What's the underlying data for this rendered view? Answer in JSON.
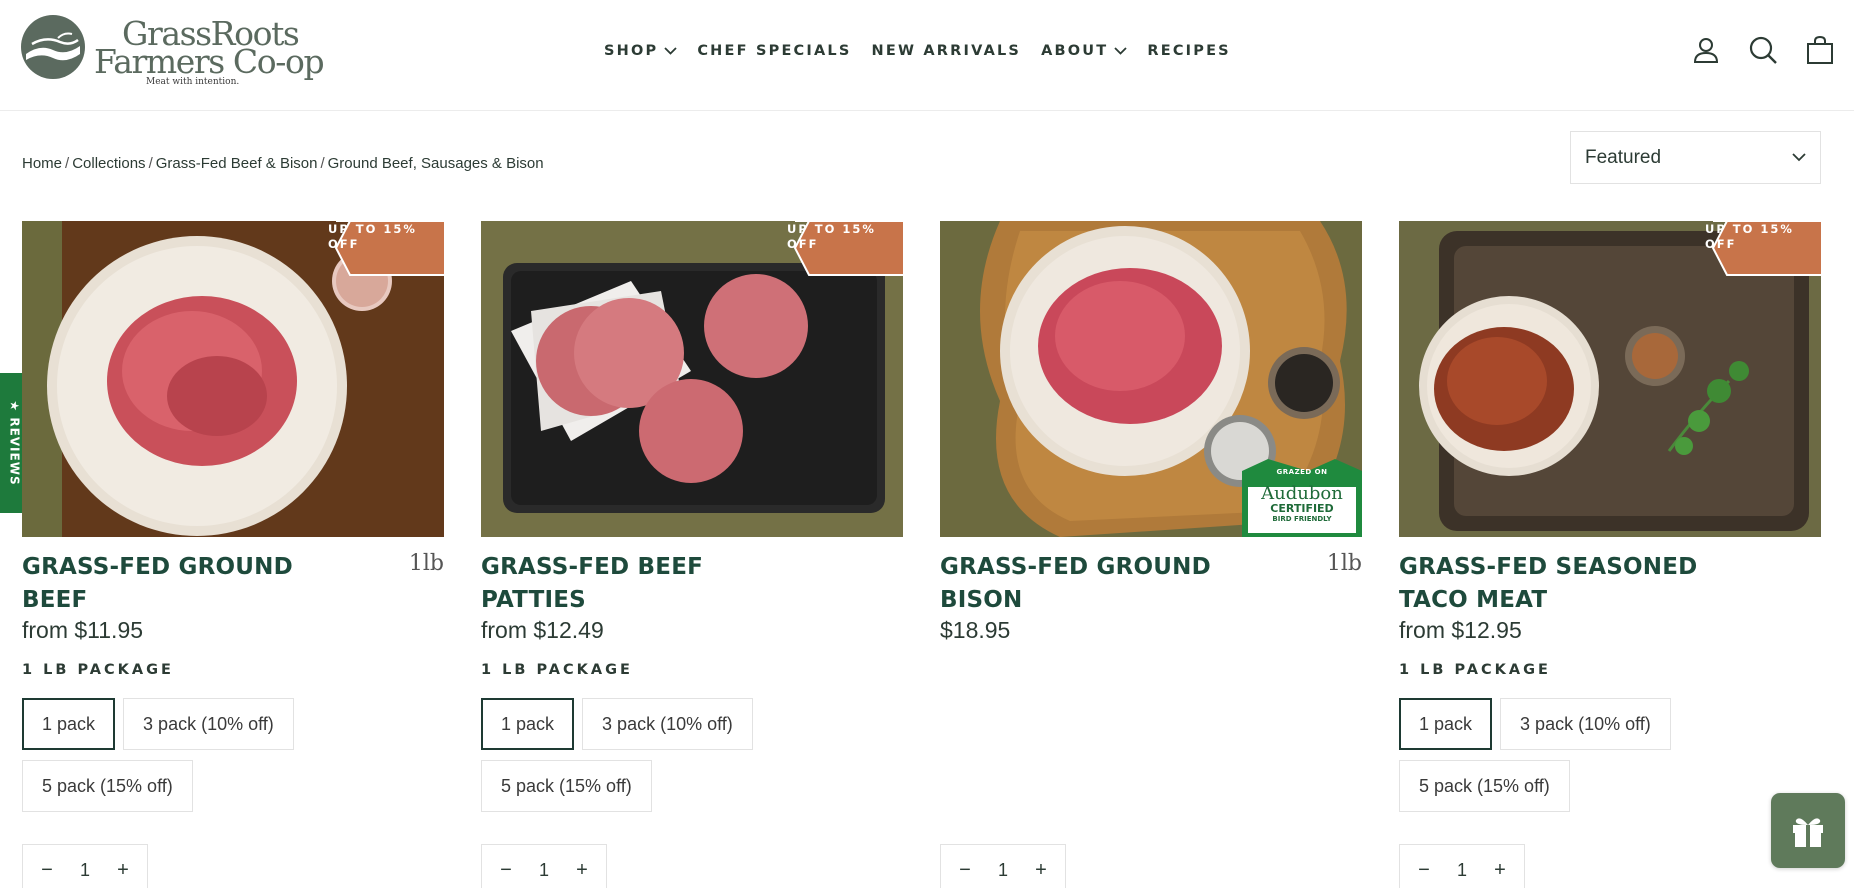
{
  "header": {
    "logo": {
      "line1": "GrassRoots",
      "line2": "Farmers Co-op",
      "tagline": "Meat with intention."
    },
    "nav": [
      {
        "label": "SHOP",
        "has_dropdown": true
      },
      {
        "label": "CHEF SPECIALS",
        "has_dropdown": false
      },
      {
        "label": "NEW ARRIVALS",
        "has_dropdown": false
      },
      {
        "label": "ABOUT",
        "has_dropdown": true
      },
      {
        "label": "RECIPES",
        "has_dropdown": false
      }
    ],
    "icons": [
      "account-icon",
      "search-icon",
      "cart-icon"
    ]
  },
  "breadcrumb": [
    {
      "label": "Home"
    },
    {
      "label": "Collections"
    },
    {
      "label": "Grass-Fed Beef & Bison"
    },
    {
      "label": "Ground Beef, Sausages & Bison"
    }
  ],
  "breadcrumb_sep": "/",
  "sort": {
    "selected": "Featured"
  },
  "reviews_tab": {
    "label": "★ REVIEWS"
  },
  "products": [
    {
      "title": "GRASS-FED GROUND BEEF",
      "weight": "1lb",
      "price": "from $11.95",
      "badge": "UP TO 15% OFF",
      "package_label": "1 LB PACKAGE",
      "options": [
        "1 pack",
        "3 pack (10% off)",
        "5 pack (15% off)"
      ],
      "selected_option": "1 pack",
      "quantity": "1"
    },
    {
      "title": "GRASS-FED BEEF PATTIES",
      "weight": "",
      "price": "from $12.49",
      "badge": "UP TO 15% OFF",
      "package_label": "1 LB PACKAGE",
      "options": [
        "1 pack",
        "3 pack (10% off)",
        "5 pack (15% off)"
      ],
      "selected_option": "1 pack",
      "quantity": "1"
    },
    {
      "title": "GRASS-FED GROUND BISON",
      "weight": "1lb",
      "price": "$18.95",
      "badge": "",
      "seal": {
        "line1": "GRAZED ON",
        "line2": "Audubon",
        "line3": "CERTIFIED",
        "line4": "BIRD FRIENDLY"
      },
      "package_label": "",
      "options": [],
      "selected_option": "",
      "quantity": "1"
    },
    {
      "title": "GRASS-FED SEASONED TACO MEAT",
      "weight": "",
      "price": "from $12.95",
      "badge": "UP TO 15% OFF",
      "package_label": "1 LB PACKAGE",
      "options": [
        "1 pack",
        "3 pack (10% off)",
        "5 pack (15% off)"
      ],
      "selected_option": "1 pack",
      "quantity": "1"
    }
  ],
  "qty_controls": {
    "minus": "−",
    "plus": "+"
  },
  "colors": {
    "brand_green": "#1e4a3c",
    "badge_orange": "#c8744a",
    "reviews_green": "#1e7a3c",
    "gift_green": "#5f7a5b"
  }
}
